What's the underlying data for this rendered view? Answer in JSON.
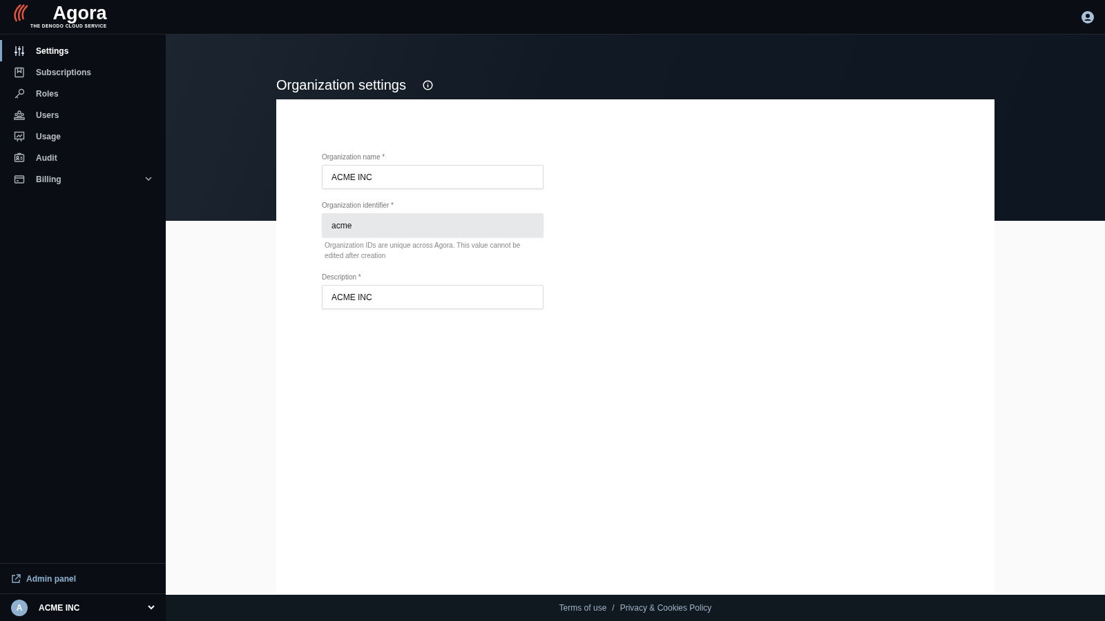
{
  "brand": {
    "name": "Agora",
    "tagline": "THE DENODO CLOUD SERVICE"
  },
  "sidebar": {
    "items": [
      {
        "label": "Settings",
        "selected": true
      },
      {
        "label": "Subscriptions",
        "selected": false
      },
      {
        "label": "Roles",
        "selected": false
      },
      {
        "label": "Users",
        "selected": false
      },
      {
        "label": "Usage",
        "selected": false
      },
      {
        "label": "Audit",
        "selected": false
      },
      {
        "label": "Billing",
        "selected": false,
        "expanded": false
      }
    ],
    "admin_link": "Admin panel",
    "organization": {
      "avatar": "A",
      "name": "ACME INC"
    }
  },
  "page": {
    "title": "Organization settings",
    "fields": [
      {
        "label": "Organization name *",
        "value": "ACME INC",
        "disabled": false
      },
      {
        "label": "Organization identifier *",
        "value": "acme",
        "disabled": true,
        "help": "Organization IDs are unique across Agora. This value cannot be edited after creation"
      },
      {
        "label": "Description *",
        "value": "ACME INC",
        "disabled": false
      }
    ]
  },
  "footer": {
    "links": [
      "Terms of use",
      "Privacy & Cookies Policy"
    ],
    "separator": "/"
  }
}
